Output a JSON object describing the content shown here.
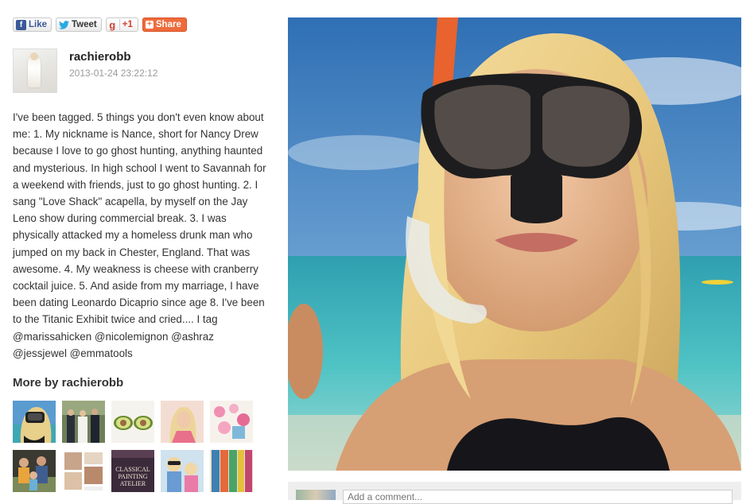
{
  "share_bar": {
    "facebook": {
      "label": "Like",
      "icon": "facebook-icon"
    },
    "twitter": {
      "label": "Tweet",
      "icon": "twitter-bird-icon"
    },
    "googleplus": {
      "icon_text": "g",
      "label": "+1"
    },
    "share": {
      "label": "Share",
      "icon": "plus-icon"
    }
  },
  "post": {
    "username": "rachierobb",
    "timestamp": "2013-01-24 23:22:12",
    "caption": "I've been tagged. 5 things you don't even know about me: 1. My nickname is Nance, short for Nancy Drew because I love to go ghost hunting, anything haunted and mysterious. In high school I went to Savannah for a weekend with friends, just to go ghost hunting. 2. I sang \"Love Shack\" acapella, by myself on the Jay Leno show during commercial break. 3. I was physically attacked my a homeless drunk man who jumped on my back in Chester, England. That was awesome. 4. My weakness is cheese with cranberry cocktail juice. 5. And aside from my marriage, I have been dating Leonardo Dicaprio since age 8. I've been to the Titanic Exhibit twice and cried.... I tag @marissahicken @nicolemignon @ashraz @jessjewel @emmatools"
  },
  "more_section": {
    "heading": "More by rachierobb"
  },
  "thumbnails": [
    {
      "subject": "snorkel-selfie"
    },
    {
      "subject": "wedding-group"
    },
    {
      "subject": "avocado-halves"
    },
    {
      "subject": "blonde-portrait"
    },
    {
      "subject": "pink-flowers"
    },
    {
      "subject": "family-beach"
    },
    {
      "subject": "photo-collage"
    },
    {
      "subject": "book-cover",
      "text": "CLASSICAL PAINTING ATELIER"
    },
    {
      "subject": "kids-sunglasses"
    },
    {
      "subject": "colorful-books"
    }
  ],
  "comment": {
    "placeholder": "Add a comment..."
  },
  "colors": {
    "facebook": "#3b5998",
    "twitter": "#2aa9e0",
    "googleplus": "#d23f31",
    "share": "#ee6b3b"
  }
}
